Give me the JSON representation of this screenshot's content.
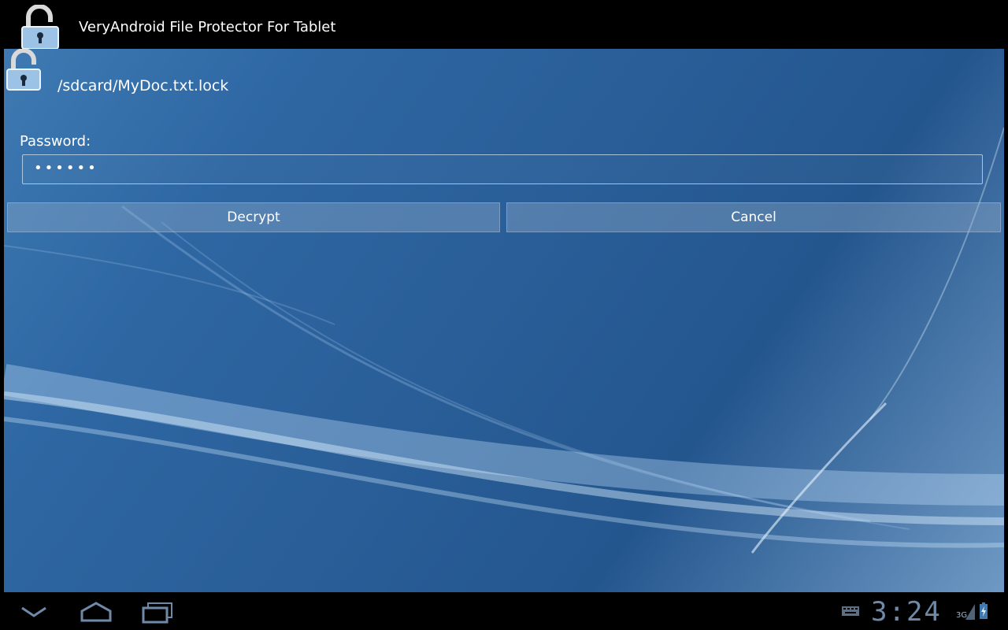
{
  "app": {
    "title": "VeryAndroid File Protector For Tablet",
    "icon": "padlock-open-icon"
  },
  "file": {
    "path": "/sdcard/MyDoc.txt.lock",
    "icon": "padlock-open-icon"
  },
  "form": {
    "password_label": "Password:",
    "password_masked": "••••••"
  },
  "buttons": {
    "decrypt": "Decrypt",
    "cancel": "Cancel"
  },
  "statusbar": {
    "time": "3:24",
    "network": "3G",
    "icons": [
      "back-icon",
      "home-icon",
      "recent-apps-icon",
      "keyboard-icon",
      "signal-icon",
      "battery-charging-icon"
    ]
  },
  "colors": {
    "wallpaper": "#2e67a3",
    "accent": "#6f8aa8"
  }
}
